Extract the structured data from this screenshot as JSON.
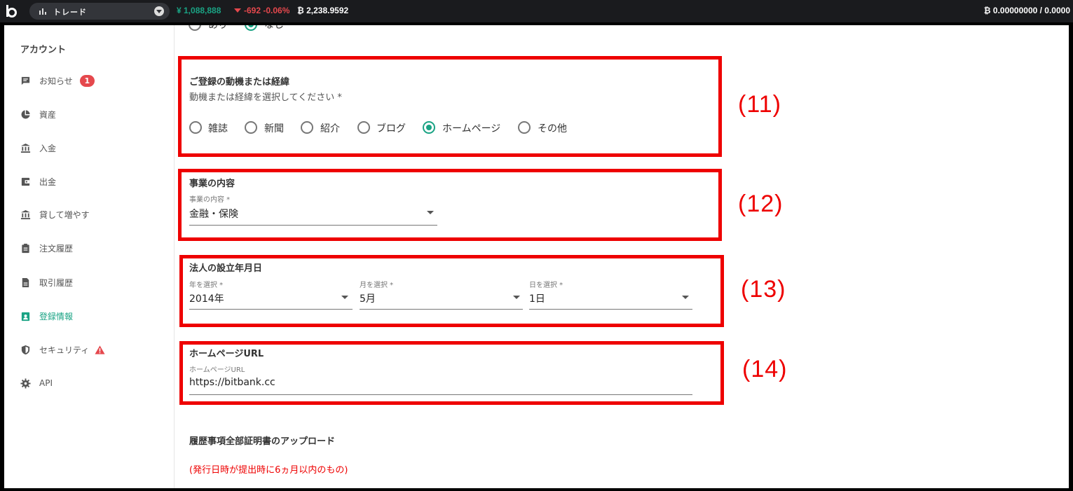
{
  "topbar": {
    "market_label": "トレード",
    "price_jpy": "¥ 1,088,888",
    "price_change": "-692 -0.06%",
    "price_btc": "₿ 2,238.9592",
    "balance": "₿ 0.00000000 / 0.0000",
    "colors": {
      "up": "#1aa384",
      "down": "#e5484d",
      "bar": "#1a1b1e"
    }
  },
  "sidebar": {
    "title": "アカウント",
    "items": [
      {
        "label": "お知らせ",
        "icon": "message-icon",
        "badge": "1"
      },
      {
        "label": "資産",
        "icon": "pie-chart-icon"
      },
      {
        "label": "入金",
        "icon": "bank-icon"
      },
      {
        "label": "出金",
        "icon": "wallet-icon"
      },
      {
        "label": "貸して増やす",
        "icon": "bank-icon"
      },
      {
        "label": "注文履歴",
        "icon": "clipboard-icon"
      },
      {
        "label": "取引履歴",
        "icon": "document-icon"
      },
      {
        "label": "登録情報",
        "icon": "account-box-icon",
        "active": true
      },
      {
        "label": "セキュリティ",
        "icon": "shield-icon",
        "warning": true
      },
      {
        "label": "API",
        "icon": "gear-icon"
      }
    ],
    "accent": "#1aa384"
  },
  "form": {
    "prev_radio": {
      "options": [
        "あり",
        "なし"
      ],
      "selected": "なし"
    },
    "motive": {
      "title": "ご登録の動機または経緯",
      "subtitle": "動機または経緯を選択してください *",
      "options": [
        "雑誌",
        "新聞",
        "紹介",
        "ブログ",
        "ホームページ",
        "その他"
      ],
      "selected": "ホームページ"
    },
    "business": {
      "title": "事業の内容",
      "field_label": "事業の内容 *",
      "value": "金融・保険"
    },
    "established": {
      "title": "法人の設立年月日",
      "year_label": "年を選択 *",
      "year_value": "2014年",
      "month_label": "月を選択 *",
      "month_value": "5月",
      "day_label": "日を選択 *",
      "day_value": "1日"
    },
    "homepage": {
      "title": "ホームページURL",
      "field_label": "ホームページURL",
      "value": "https://bitbank.cc"
    },
    "upload": {
      "title": "履歴事項全部証明書のアップロード",
      "note": "(発行日時が提出時に6ヵ月以内のもの)"
    }
  },
  "annotations": {
    "labels": [
      "(11)",
      "(12)",
      "(13)",
      "(14)"
    ],
    "color": "#ee0000"
  }
}
